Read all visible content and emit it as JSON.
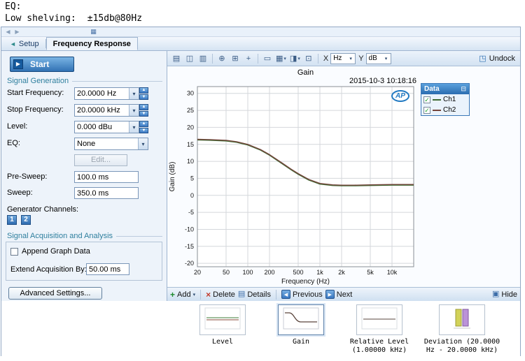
{
  "page_header": {
    "eq_line": "EQ:",
    "shelving_label": "Low shelving:",
    "shelving_value": "±15db@80Hz"
  },
  "tab_bar": {
    "setup_label": "Setup",
    "active_tab": "Frequency Response"
  },
  "left_panel": {
    "start_button": "Start",
    "signal_generation_title": "Signal Generation",
    "fields": {
      "start_freq": {
        "label": "Start Frequency:",
        "value": "20.0000 Hz"
      },
      "stop_freq": {
        "label": "Stop Frequency:",
        "value": "20.0000 kHz"
      },
      "level": {
        "label": "Level:",
        "value": "0.000 dBu"
      },
      "eq": {
        "label": "EQ:",
        "value": "None"
      }
    },
    "edit_button": "Edit...",
    "pre_sweep": {
      "label": "Pre-Sweep:",
      "value": "100.0 ms"
    },
    "sweep": {
      "label": "Sweep:",
      "value": "350.0 ms"
    },
    "generator_channels_label": "Generator Channels:",
    "channel_1": "1",
    "channel_2": "2",
    "acquisition_title": "Signal Acquisition and Analysis",
    "append_graph_data_label": "Append Graph Data",
    "extend_label": "Extend Acquisition By:",
    "extend_value": "50.00 ms",
    "advanced_button": "Advanced Settings..."
  },
  "graph_toolbar": {
    "x_axis_label": "X",
    "x_axis_unit": "Hz",
    "y_axis_label": "Y",
    "y_axis_unit": "dB",
    "undock_label": "Undock"
  },
  "chart_data": {
    "type": "line",
    "title": "Gain",
    "timestamp": "2015-10-3 10:18:16",
    "xlabel": "Frequency (Hz)",
    "ylabel": "Gain (dB)",
    "x_scale": "log",
    "xlim": [
      20,
      20000
    ],
    "ylim": [
      -21,
      32
    ],
    "x_ticks": [
      {
        "v": 20,
        "label": "20"
      },
      {
        "v": 50,
        "label": "50"
      },
      {
        "v": 100,
        "label": "100"
      },
      {
        "v": 200,
        "label": "200"
      },
      {
        "v": 500,
        "label": "500"
      },
      {
        "v": 1000,
        "label": "1k"
      },
      {
        "v": 2000,
        "label": "2k"
      },
      {
        "v": 5000,
        "label": "5k"
      },
      {
        "v": 10000,
        "label": "10k"
      }
    ],
    "y_ticks": [
      30,
      25,
      20,
      15,
      10,
      5,
      0,
      -5,
      -10,
      -15,
      -20
    ],
    "grid": true,
    "legend_position": "right",
    "series": [
      {
        "name": "Ch1",
        "color": "#3f6b33",
        "x": [
          20,
          30,
          50,
          70,
          100,
          150,
          200,
          300,
          400,
          500,
          700,
          1000,
          1500,
          2000,
          3000,
          5000,
          10000,
          20000
        ],
        "y": [
          16.3,
          16.2,
          16.0,
          15.6,
          14.8,
          13.3,
          11.8,
          9.3,
          7.5,
          6.2,
          4.5,
          3.3,
          2.9,
          2.8,
          2.8,
          2.9,
          3.0,
          3.0
        ]
      },
      {
        "name": "Ch2",
        "color": "#74453c",
        "x": [
          20,
          30,
          50,
          70,
          100,
          150,
          200,
          300,
          400,
          500,
          700,
          1000,
          1500,
          2000,
          3000,
          5000,
          10000,
          20000
        ],
        "y": [
          16.5,
          16.4,
          16.2,
          15.8,
          15.0,
          13.5,
          12.0,
          9.5,
          7.7,
          6.4,
          4.7,
          3.5,
          3.1,
          3.0,
          3.0,
          3.1,
          3.2,
          3.2
        ]
      }
    ]
  },
  "legend": {
    "title": "Data",
    "items": [
      {
        "label": "Ch1",
        "checked": true,
        "color": "#3f6b33"
      },
      {
        "label": "Ch2",
        "checked": true,
        "color": "#74453c"
      }
    ]
  },
  "ap_logo": "AP",
  "bottom_toolbar": {
    "add": "Add",
    "delete": "Delete",
    "details": "Details",
    "previous": "Previous",
    "next": "Next",
    "hide": "Hide"
  },
  "thumbnails": [
    {
      "label": "Level",
      "selected": false
    },
    {
      "label": "Gain",
      "selected": true
    },
    {
      "label": "Relative Level (1.00000 kHz)",
      "selected": false
    },
    {
      "label": "Deviation (20.0000 Hz - 20.0000 kHz)",
      "selected": false
    }
  ],
  "icons": {
    "play": "▶",
    "check": "✓",
    "dropdown_arrow": "▾",
    "spin_up": "▲",
    "spin_down": "▼",
    "save": "▤",
    "copy": "◫",
    "print": "▥",
    "zoom": "⊕",
    "fit": "⊞",
    "crosshair": "+",
    "select_rect": "▭",
    "graph_style": "▦",
    "chart_view": "◨",
    "config": "⊡",
    "undock": "◳",
    "add": "+",
    "delete": "×",
    "details": "▤",
    "previous": "◀",
    "next": "▶",
    "hide": "▣",
    "legend_pin": "⊟",
    "setup_arrow": "◄",
    "nav_left": "◀",
    "nav_right": "▶",
    "window": "▦"
  }
}
